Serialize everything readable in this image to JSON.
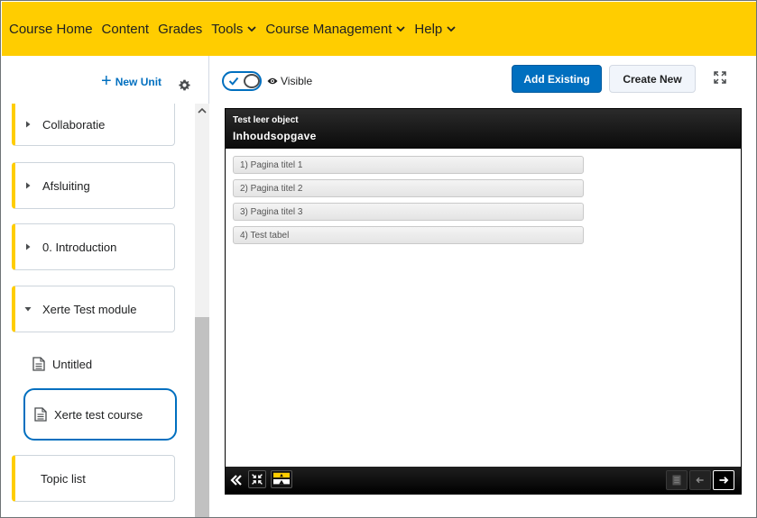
{
  "topnav": {
    "items": [
      {
        "label": "Course Home",
        "dropdown": false
      },
      {
        "label": "Content",
        "dropdown": false
      },
      {
        "label": "Grades",
        "dropdown": false
      },
      {
        "label": "Tools",
        "dropdown": true
      },
      {
        "label": "Course Management",
        "dropdown": true
      },
      {
        "label": "Help",
        "dropdown": true
      }
    ],
    "bg_color": "#ffcd00"
  },
  "sidebar": {
    "new_unit_label": "New Unit",
    "units": [
      {
        "label": "Collaboratie",
        "expanded": false
      },
      {
        "label": "Afsluiting",
        "expanded": false
      },
      {
        "label": "0. Introduction",
        "expanded": false
      },
      {
        "label": "Xerte Test module",
        "expanded": true
      }
    ],
    "topics": [
      {
        "label": "Untitled",
        "selected": false
      },
      {
        "label": "Xerte test course",
        "selected": true
      }
    ],
    "topic_list_label": "Topic list"
  },
  "toolbar": {
    "visibility_label": "Visible",
    "add_existing_label": "Add Existing",
    "create_new_label": "Create New"
  },
  "viewer": {
    "title": "Test leer object",
    "subtitle": "Inhoudsopgave",
    "toc": [
      "1) Pagina titel 1",
      "2) Pagina titel 2",
      "3) Pagina titel 3",
      "4) Test tabel"
    ]
  },
  "colors": {
    "accent": "#006fbf",
    "brand_yellow": "#ffcd00"
  }
}
